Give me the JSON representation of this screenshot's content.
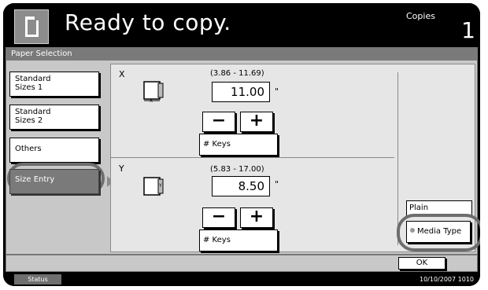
{
  "header": {
    "title": "Ready to copy.",
    "copies_label": "Copies",
    "copies_value": "1",
    "doc_icon": "document-icon"
  },
  "panel": {
    "title": "Paper Selection",
    "sidebar": {
      "standard_sizes_1": "Standard\nSizes 1",
      "standard_sizes_2": "Standard\nSizes 2",
      "others": "Others",
      "size_entry": "Size Entry"
    }
  },
  "entry": {
    "x": {
      "label": "X",
      "range": "(3.86 - 11.69)",
      "value": "11.00",
      "unit": "\"",
      "minus": "−",
      "plus": "+",
      "keys": "# Keys",
      "icon": "paper-width-icon"
    },
    "y": {
      "label": "Y",
      "range": "(5.83 - 17.00)",
      "value": "8.50",
      "unit": "\"",
      "minus": "−",
      "plus": "+",
      "keys": "# Keys",
      "icon": "paper-length-icon"
    }
  },
  "media": {
    "current": "Plain",
    "button": "Media Type"
  },
  "footer": {
    "ok": "OK",
    "status": "Status",
    "datetime": "10/10/2007  1010"
  },
  "colors": {
    "panel_bg": "#c8c8c8",
    "selected_bg": "#7a7a7a",
    "highlight": "#6d6d6d"
  }
}
